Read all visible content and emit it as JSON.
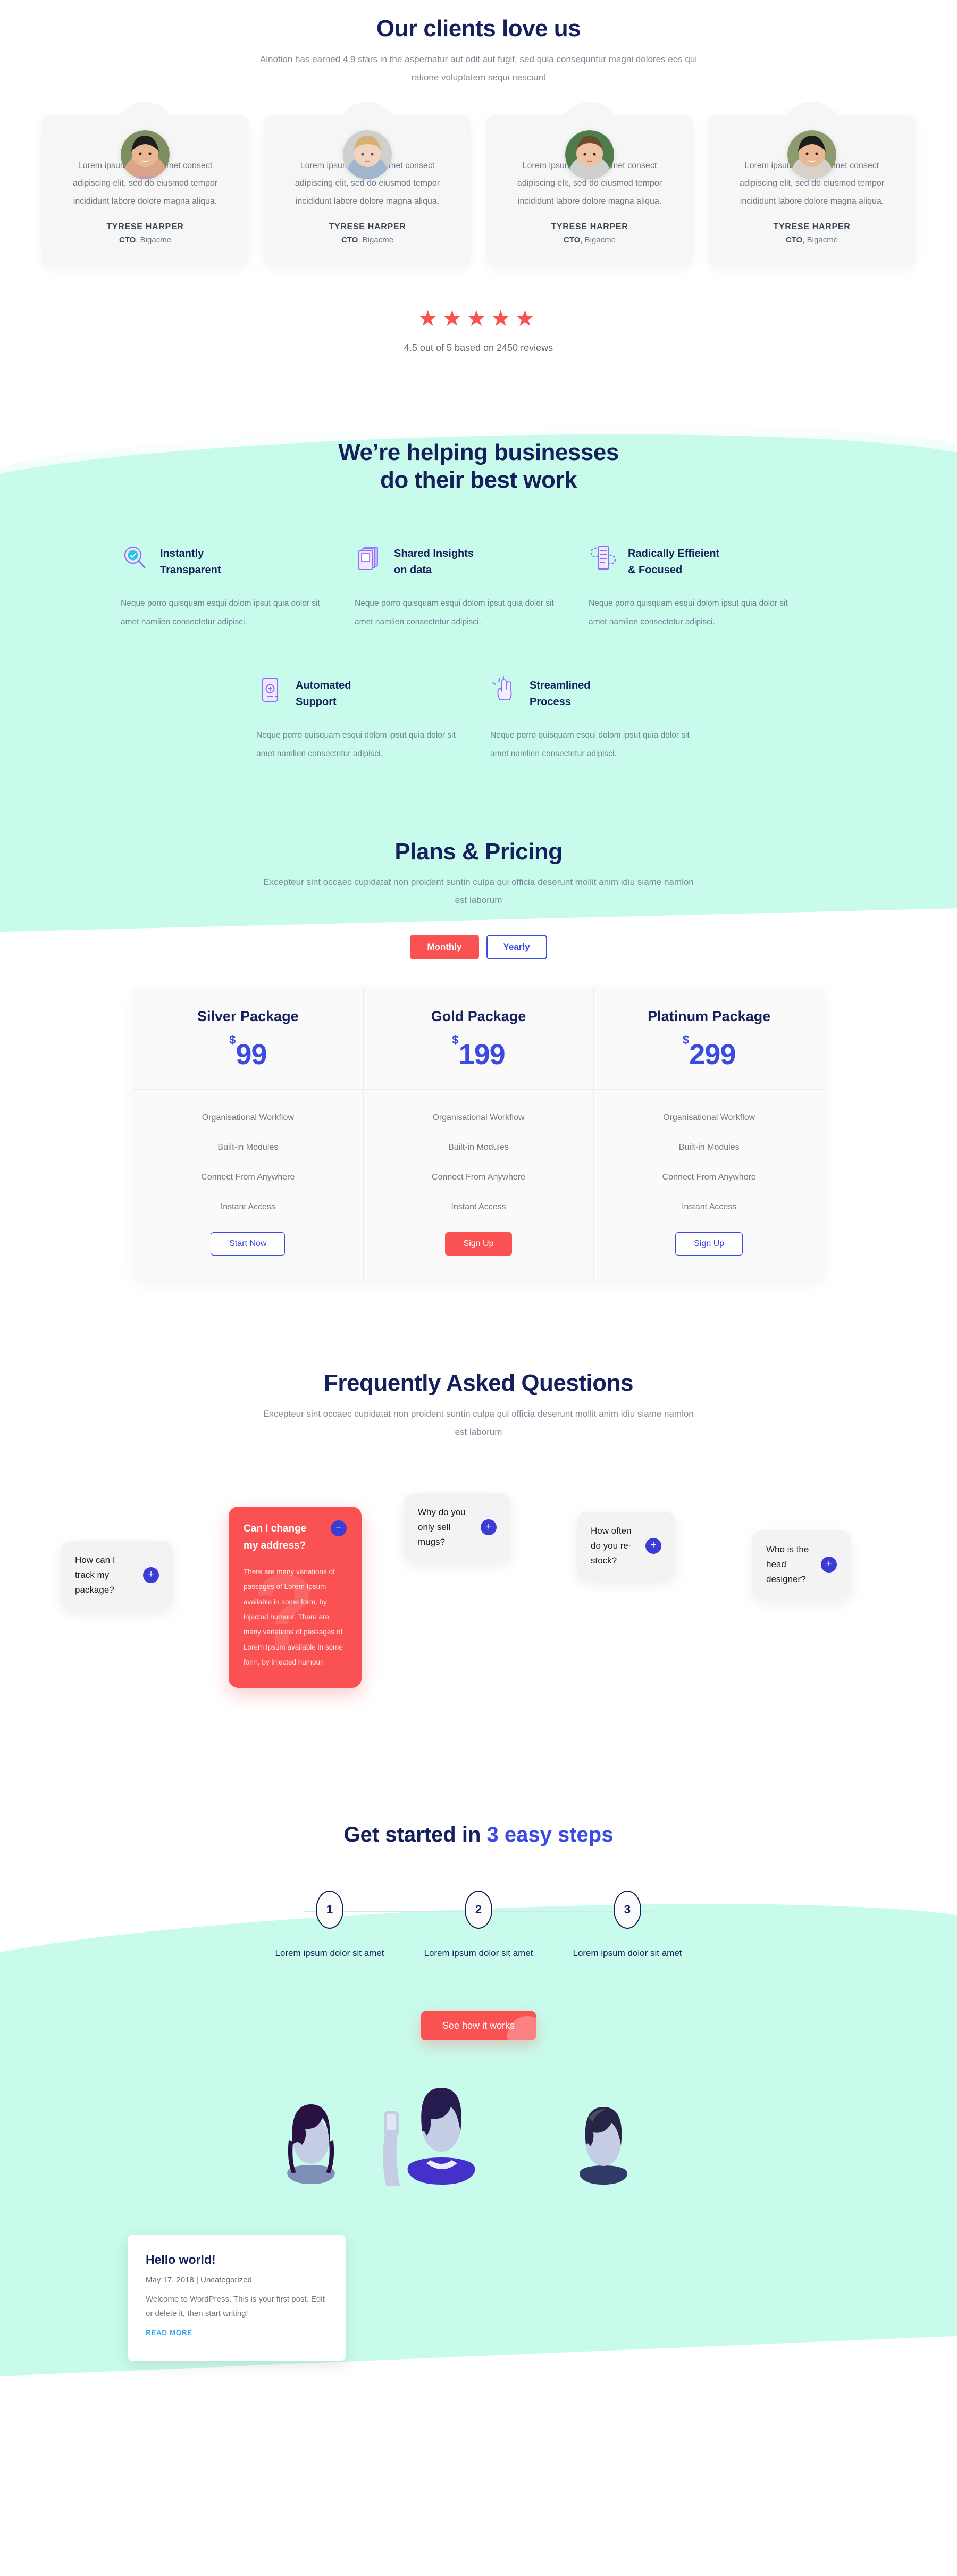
{
  "testimonials_section": {
    "title": "Our clients love us",
    "subtitle": "Ainotion has earned 4.9 stars in the aspernatur aut odit aut fugit, sed quia consequntur magni dolores eos qui ratione voluptatem sequi nesciunt",
    "cards": [
      {
        "quote": "Lorem ipsum dolor sit amet consect adipiscing elit, sed do eiusmod tempor incididunt labore dolore magna aliqua.",
        "name": "TYRESE HARPER",
        "role_title": "CTO",
        "role_company": ", Bigacme"
      },
      {
        "quote": "Lorem ipsum dolor sit amet consect adipiscing elit, sed do eiusmod tempor incididunt labore dolore magna aliqua.",
        "name": "TYRESE HARPER",
        "role_title": "CTO",
        "role_company": ", Bigacme"
      },
      {
        "quote": "Lorem ipsum dolor sit amet consect adipiscing elit, sed do eiusmod tempor incididunt labore dolore magna aliqua.",
        "name": "TYRESE HARPER",
        "role_title": "CTO",
        "role_company": ", Bigacme"
      },
      {
        "quote": "Lorem ipsum dolor sit amet consect adipiscing elit, sed do eiusmod tempor incididunt labore dolore magna aliqua.",
        "name": "TYRESE HARPER",
        "role_title": "CTO",
        "role_company": ", Bigacme"
      }
    ],
    "stars": "★★★★★",
    "star_count": 5,
    "rating_text": "4.5 out of 5 based on 2450 reviews",
    "star_color": "#fa5252"
  },
  "features_section": {
    "title_line1": "We’re helping businesses",
    "title_line2": "do their best work",
    "items": [
      {
        "icon": "magnifier-check-icon",
        "title_line1": "Instantly",
        "title_line2": "Transparent",
        "text": "Neque porro quisquam esqui dolom ipsut quia dolor sit amet namlien consectetur adipisci."
      },
      {
        "icon": "stacked-books-icon",
        "title_line1": "Shared Insights",
        "title_line2": "on data",
        "text": "Neque porro quisquam esqui dolom ipsut quia dolor sit amet namlien consectetur adipisci."
      },
      {
        "icon": "document-gear-icon",
        "title_line1": "Radically Effieient",
        "title_line2": "& Focused",
        "text": "Neque porro quisquam esqui dolom ipsut quia dolor sit amet namlien consectetur adipisci."
      },
      {
        "icon": "mobile-download-icon",
        "title_line1": "Automated",
        "title_line2": "Support",
        "text": "Neque porro quisquam esqui dolom ipsut quia dolor sit amet namlien consectetur adipisci."
      },
      {
        "icon": "hand-swipe-icon",
        "title_line1": "Streamlined",
        "title_line2": "Process",
        "text": "Neque porro quisquam esqui dolom ipsut quia dolor sit amet namlien consectetur adipisci."
      }
    ],
    "background_color": "#c8fbec"
  },
  "pricing_section": {
    "title": "Plans & Pricing",
    "subtitle": "Excepteur sint occaec cupidatat non proident suntin culpa qui officia deserunt mollit anim idiu siame namlon est laborum",
    "toggle": {
      "monthly": "Monthly",
      "yearly": "Yearly",
      "selected": "Monthly"
    },
    "plans": [
      {
        "name": "Silver Package",
        "currency": "$",
        "price": "99",
        "features": [
          "Organisational Workflow",
          "Built-in Modules",
          "Connect From Anywhere",
          "Instant Access"
        ],
        "cta": "Start Now",
        "cta_style": "outline"
      },
      {
        "name": "Gold Package",
        "currency": "$",
        "price": "199",
        "features": [
          "Organisational Workflow",
          "Built-in Modules",
          "Connect From Anywhere",
          "Instant Access"
        ],
        "cta": "Sign Up",
        "cta_style": "solid"
      },
      {
        "name": "Platinum Package",
        "currency": "$",
        "price": "299",
        "features": [
          "Organisational Workflow",
          "Built-in Modules",
          "Connect From Anywhere",
          "Instant Access"
        ],
        "cta": "Sign Up",
        "cta_style": "outline"
      }
    ],
    "accent_blue": "#3b4ae0",
    "accent_red": "#fa5252"
  },
  "faq_section": {
    "title": "Frequently Asked Questions",
    "subtitle": "Excepteur sint occaec cupidatat non proident suntin culpa qui officia deserunt mollit anim idiu siame namlon est laborum",
    "items": [
      {
        "question": "How can I track my package?",
        "state": "collapsed",
        "toggle": "+"
      },
      {
        "question": "Can I change my address?",
        "state": "expanded",
        "toggle": "−",
        "answer": "There are many variations of passages of Lorem Ipsum available in some form, by injected humour. There are many variations of passages of Lorem Ipsum available in some form, by injected humour.",
        "watermark": "?"
      },
      {
        "question": "Why do you only sell mugs?",
        "state": "collapsed",
        "toggle": "+"
      },
      {
        "question": "How often do you re-stock?",
        "state": "collapsed",
        "toggle": "+"
      },
      {
        "question": "Who is the head designer?",
        "state": "collapsed",
        "toggle": "+"
      }
    ],
    "open_card_color": "#fa5252",
    "toggle_color": "#3b3bd6"
  },
  "steps_section": {
    "title_prefix": "Get started in ",
    "title_highlight": "3 easy steps",
    "steps": [
      {
        "number": "1",
        "label": "Lorem ipsum dolor sit amet"
      },
      {
        "number": "2",
        "label": "Lorem ipsum dolor sit amet"
      },
      {
        "number": "3",
        "label": "Lorem ipsum dolor sit amet"
      }
    ],
    "cta": "See how it works",
    "background_color": "#c8fbec"
  },
  "blog_section": {
    "post": {
      "title": "Hello world!",
      "meta": "May 17, 2018 | Uncategorized",
      "excerpt": "Welcome to WordPress. This is your first post. Edit or delete it, then start writing!",
      "read_more": "READ MORE"
    }
  }
}
